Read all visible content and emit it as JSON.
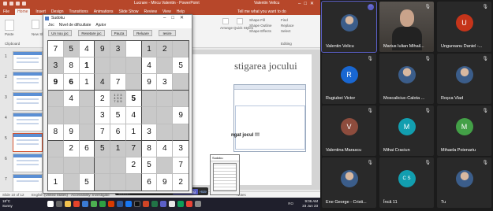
{
  "ppt": {
    "title": "Lucrare - Mircu Valentin - PowerPoint",
    "user": "Valentin Velicu",
    "tabs": [
      "File",
      "Home",
      "Insert",
      "Design",
      "Transitions",
      "Animations",
      "Slide Show",
      "Review",
      "View",
      "Help"
    ],
    "active_tab": "Home",
    "tell_me": "Tell me what you want to do",
    "ribbon": {
      "clipboard": "Clipboard",
      "paste": "Paste",
      "new_slide": "New Slide",
      "arrange": "Arrange",
      "quick_styles": "Quick Styles",
      "shape_fill": "Shape Fill",
      "shape_outline": "Shape Outline",
      "shape_effects": "Shape Effects",
      "find": "Find",
      "replace": "Replace",
      "select": "Select",
      "editing": "Editing"
    },
    "slide_numbers": [
      "1",
      "2",
      "3",
      "4",
      "5",
      "6",
      "7",
      "8"
    ],
    "slide_title": "stigarea jocului",
    "slide_finish_text": "ngat jocul !!!",
    "notes_placeholder": "Click to add notes",
    "status": {
      "slide_of": "Slide 10 of 12",
      "language": "English (United States)",
      "accessibility": "Accessibility: Investigate",
      "notes": "Notes"
    },
    "share_bar": {
      "text": "meet.google.com is sharing your screen.",
      "stop": "Stop sharing",
      "hide": "Hide"
    }
  },
  "sudoku": {
    "title": "Sudoku",
    "menu": [
      "Joc",
      "Nivel de dificultate",
      "Ajutor"
    ],
    "buttons": [
      "Un nou joc",
      "Resetare joc",
      "Pauza",
      "Reluare",
      "Iesire"
    ],
    "grid": [
      [
        "7",
        "5",
        "4",
        "9",
        "3",
        "",
        "1",
        "2",
        ""
      ],
      [
        "3",
        "8",
        "1",
        "",
        "",
        "",
        "4",
        "",
        "5"
      ],
      [
        "9",
        "6",
        "1",
        "4",
        "7",
        "",
        "9",
        "3",
        ""
      ],
      [
        "",
        "4",
        "",
        "2",
        "NOTES",
        "5",
        "",
        "",
        ""
      ],
      [
        "",
        "",
        "",
        "3",
        "5",
        "4",
        "",
        "",
        "9"
      ],
      [
        "8",
        "9",
        "",
        "7",
        "6",
        "1",
        "3",
        "",
        ""
      ],
      [
        "",
        "2",
        "6",
        "5",
        "1",
        "7",
        "8",
        "4",
        "3"
      ],
      [
        "",
        "",
        "",
        "",
        "",
        "2",
        "5",
        "",
        "7"
      ],
      [
        "1",
        "",
        "5",
        "",
        "",
        "",
        "6",
        "9",
        "2"
      ]
    ],
    "shaded": [
      [
        0,
        1,
        0,
        1,
        1,
        0,
        1,
        1,
        1
      ],
      [
        1,
        0,
        0,
        1,
        1,
        1,
        0,
        1,
        0
      ],
      [
        0,
        0,
        0,
        1,
        0,
        1,
        0,
        0,
        1
      ],
      [
        1,
        0,
        1,
        0,
        1,
        0,
        1,
        1,
        1
      ],
      [
        1,
        1,
        1,
        0,
        0,
        0,
        1,
        1,
        0
      ],
      [
        0,
        0,
        1,
        0,
        0,
        0,
        0,
        1,
        1
      ],
      [
        1,
        0,
        0,
        1,
        1,
        1,
        0,
        0,
        0
      ],
      [
        1,
        1,
        1,
        1,
        1,
        0,
        0,
        1,
        0
      ],
      [
        0,
        1,
        0,
        1,
        1,
        1,
        0,
        0,
        0
      ]
    ],
    "bold": [
      [
        2,
        0
      ],
      [
        2,
        1
      ],
      [
        1,
        2
      ],
      [
        3,
        5
      ]
    ],
    "notes_cell": [
      "1",
      "2",
      "3",
      "4",
      "5",
      "6",
      "7",
      "8",
      "9"
    ],
    "mini_title": "Sudoku"
  },
  "taskbar": {
    "weather_temp": "18°C",
    "weather_text": "Sunny",
    "tray": "RO",
    "time": "9:06 AM",
    "date": "23 Jun 23"
  },
  "participants": [
    {
      "name": "Valentin Velicu",
      "initial": "",
      "color": "",
      "photo": true,
      "more": true,
      "active": true
    },
    {
      "name": "Marius Iulian Mihail...",
      "initial": "",
      "color": "",
      "photo": true,
      "video": true
    },
    {
      "name": "Ungureanu Daniel -...",
      "initial": "U",
      "color": "#c5341a"
    },
    {
      "name": "Rugiubei Victor",
      "initial": "R",
      "color": "#1967d2"
    },
    {
      "name": "Moscaliciuc-Calota ...",
      "initial": "",
      "color": "",
      "photo": true
    },
    {
      "name": "Roșca Vlad",
      "initial": "",
      "color": "",
      "photo": true
    },
    {
      "name": "Valentina Marascu",
      "initial": "V",
      "color": "#8d4c3d"
    },
    {
      "name": "Mihai Craciun",
      "initial": "M",
      "color": "#129eaf"
    },
    {
      "name": "Mihaela Poienariu",
      "initial": "M",
      "color": "#43a047"
    },
    {
      "name": "Ene George - Cristi...",
      "initial": "",
      "color": "",
      "photo": true
    },
    {
      "name": "Încă 11",
      "initial": "C S",
      "color": "#129eaf"
    },
    {
      "name": "Tu",
      "initial": "",
      "color": "",
      "photo": true
    }
  ]
}
